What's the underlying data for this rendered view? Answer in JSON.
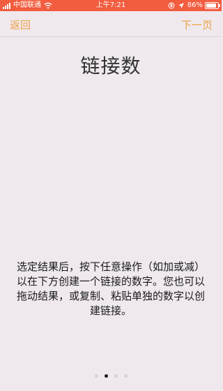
{
  "status_bar": {
    "carrier": "中国联通",
    "time": "上午7:21",
    "battery_percent_text": "86%",
    "battery_level": 0.86,
    "background_color": "#f25c3f",
    "icons": [
      "signal-icon",
      "wifi-icon",
      "orientation-lock-icon",
      "location-arrow-icon",
      "battery-icon"
    ]
  },
  "nav": {
    "back_label": "返回",
    "next_label": "下一页",
    "accent_color": "#f0a048"
  },
  "main": {
    "title": "链接数",
    "instructions": "选定结果后，按下任意操作（如加或减）以在下方创建一个链接的数字。您也可以拖动结果，或复制、粘贴单独的数字以创建链接。"
  },
  "pager": {
    "count": 4,
    "active_index": 1
  }
}
